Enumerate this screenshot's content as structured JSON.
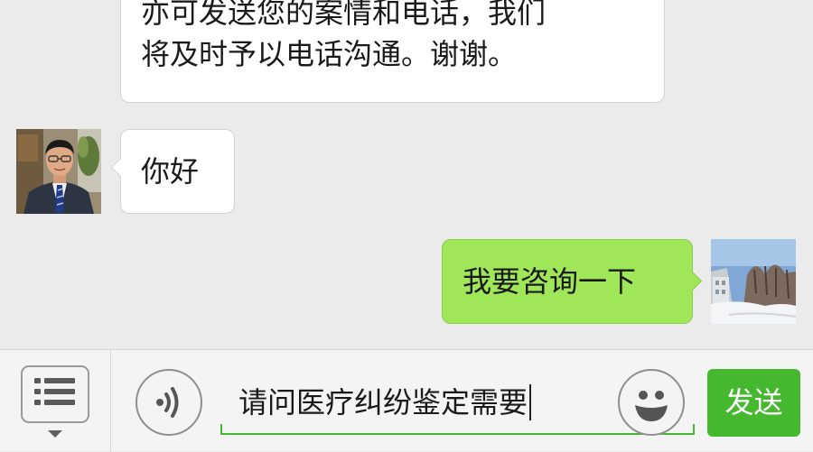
{
  "chat": {
    "messages": [
      {
        "sender": "contact",
        "lines": [
          "亦可发送您的案情和电话，我们",
          "将及时予以电话沟通。谢谢。"
        ]
      },
      {
        "sender": "contact",
        "avatar": "lawyer-portrait-avatar",
        "text": "你好"
      },
      {
        "sender": "me",
        "avatar": "snowy-landscape-avatar",
        "text": "我要咨询一下"
      }
    ]
  },
  "input_bar": {
    "menu_icon": "list-menu-icon",
    "voice_icon": "voice-wave-icon",
    "emoji_icon": "smiley-face-icon",
    "draft_text": "请问医疗纠纷鉴定需要",
    "send_label": "发送"
  },
  "colors": {
    "chat_background": "#ebebeb",
    "incoming_bubble": "#ffffff",
    "outgoing_bubble": "#9fe658",
    "accent_green": "#46b830"
  }
}
